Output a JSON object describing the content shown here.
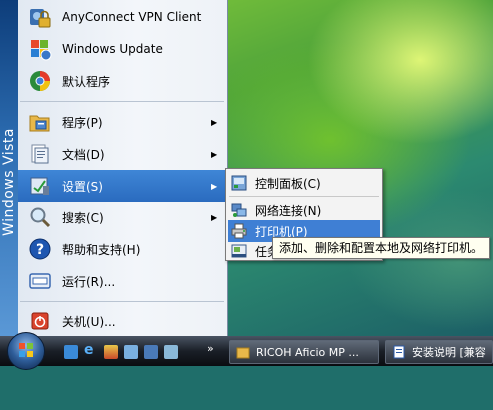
{
  "os_brand": "Windows Vista",
  "start_menu": {
    "pinned": [
      {
        "label": "AnyConnect VPN Client",
        "icon": "lock-icon"
      },
      {
        "label": "Windows Update",
        "icon": "windows-update-icon"
      },
      {
        "label": "默认程序",
        "icon": "default-programs-icon"
      }
    ],
    "items": [
      {
        "label": "程序(P)",
        "icon": "programs-folder-icon",
        "has_submenu": true
      },
      {
        "label": "文档(D)",
        "icon": "documents-icon",
        "has_submenu": true
      },
      {
        "label": "设置(S)",
        "icon": "settings-icon",
        "has_submenu": true,
        "selected": true
      },
      {
        "label": "搜索(C)",
        "icon": "search-icon",
        "has_submenu": true
      },
      {
        "label": "帮助和支持(H)",
        "icon": "help-icon",
        "has_submenu": false
      },
      {
        "label": "运行(R)...",
        "icon": "run-icon",
        "has_submenu": false
      }
    ],
    "shutdown": {
      "label": "关机(U)...",
      "icon": "power-icon"
    }
  },
  "settings_submenu": {
    "items": [
      {
        "label": "控制面板(C)",
        "icon": "control-panel-icon"
      },
      {
        "label": "网络连接(N)",
        "icon": "network-icon"
      },
      {
        "label": "打印机(P)",
        "icon": "printer-icon",
        "hover": true
      },
      {
        "label": "任务",
        "icon": "taskbar-icon"
      }
    ]
  },
  "tooltip": "添加、删除和配置本地及网络打印机。",
  "taskbar": {
    "chevron": "»",
    "tasks": [
      {
        "label": "RICOH Aficio MP ...",
        "icon": "folder-icon"
      },
      {
        "label": "安装说明 [兼容",
        "icon": "word-document-icon"
      }
    ]
  },
  "colors": {
    "selection": "#2a6bbf",
    "submenu_hover": "#3f7fd4",
    "taskbar": "#1a1f27"
  }
}
